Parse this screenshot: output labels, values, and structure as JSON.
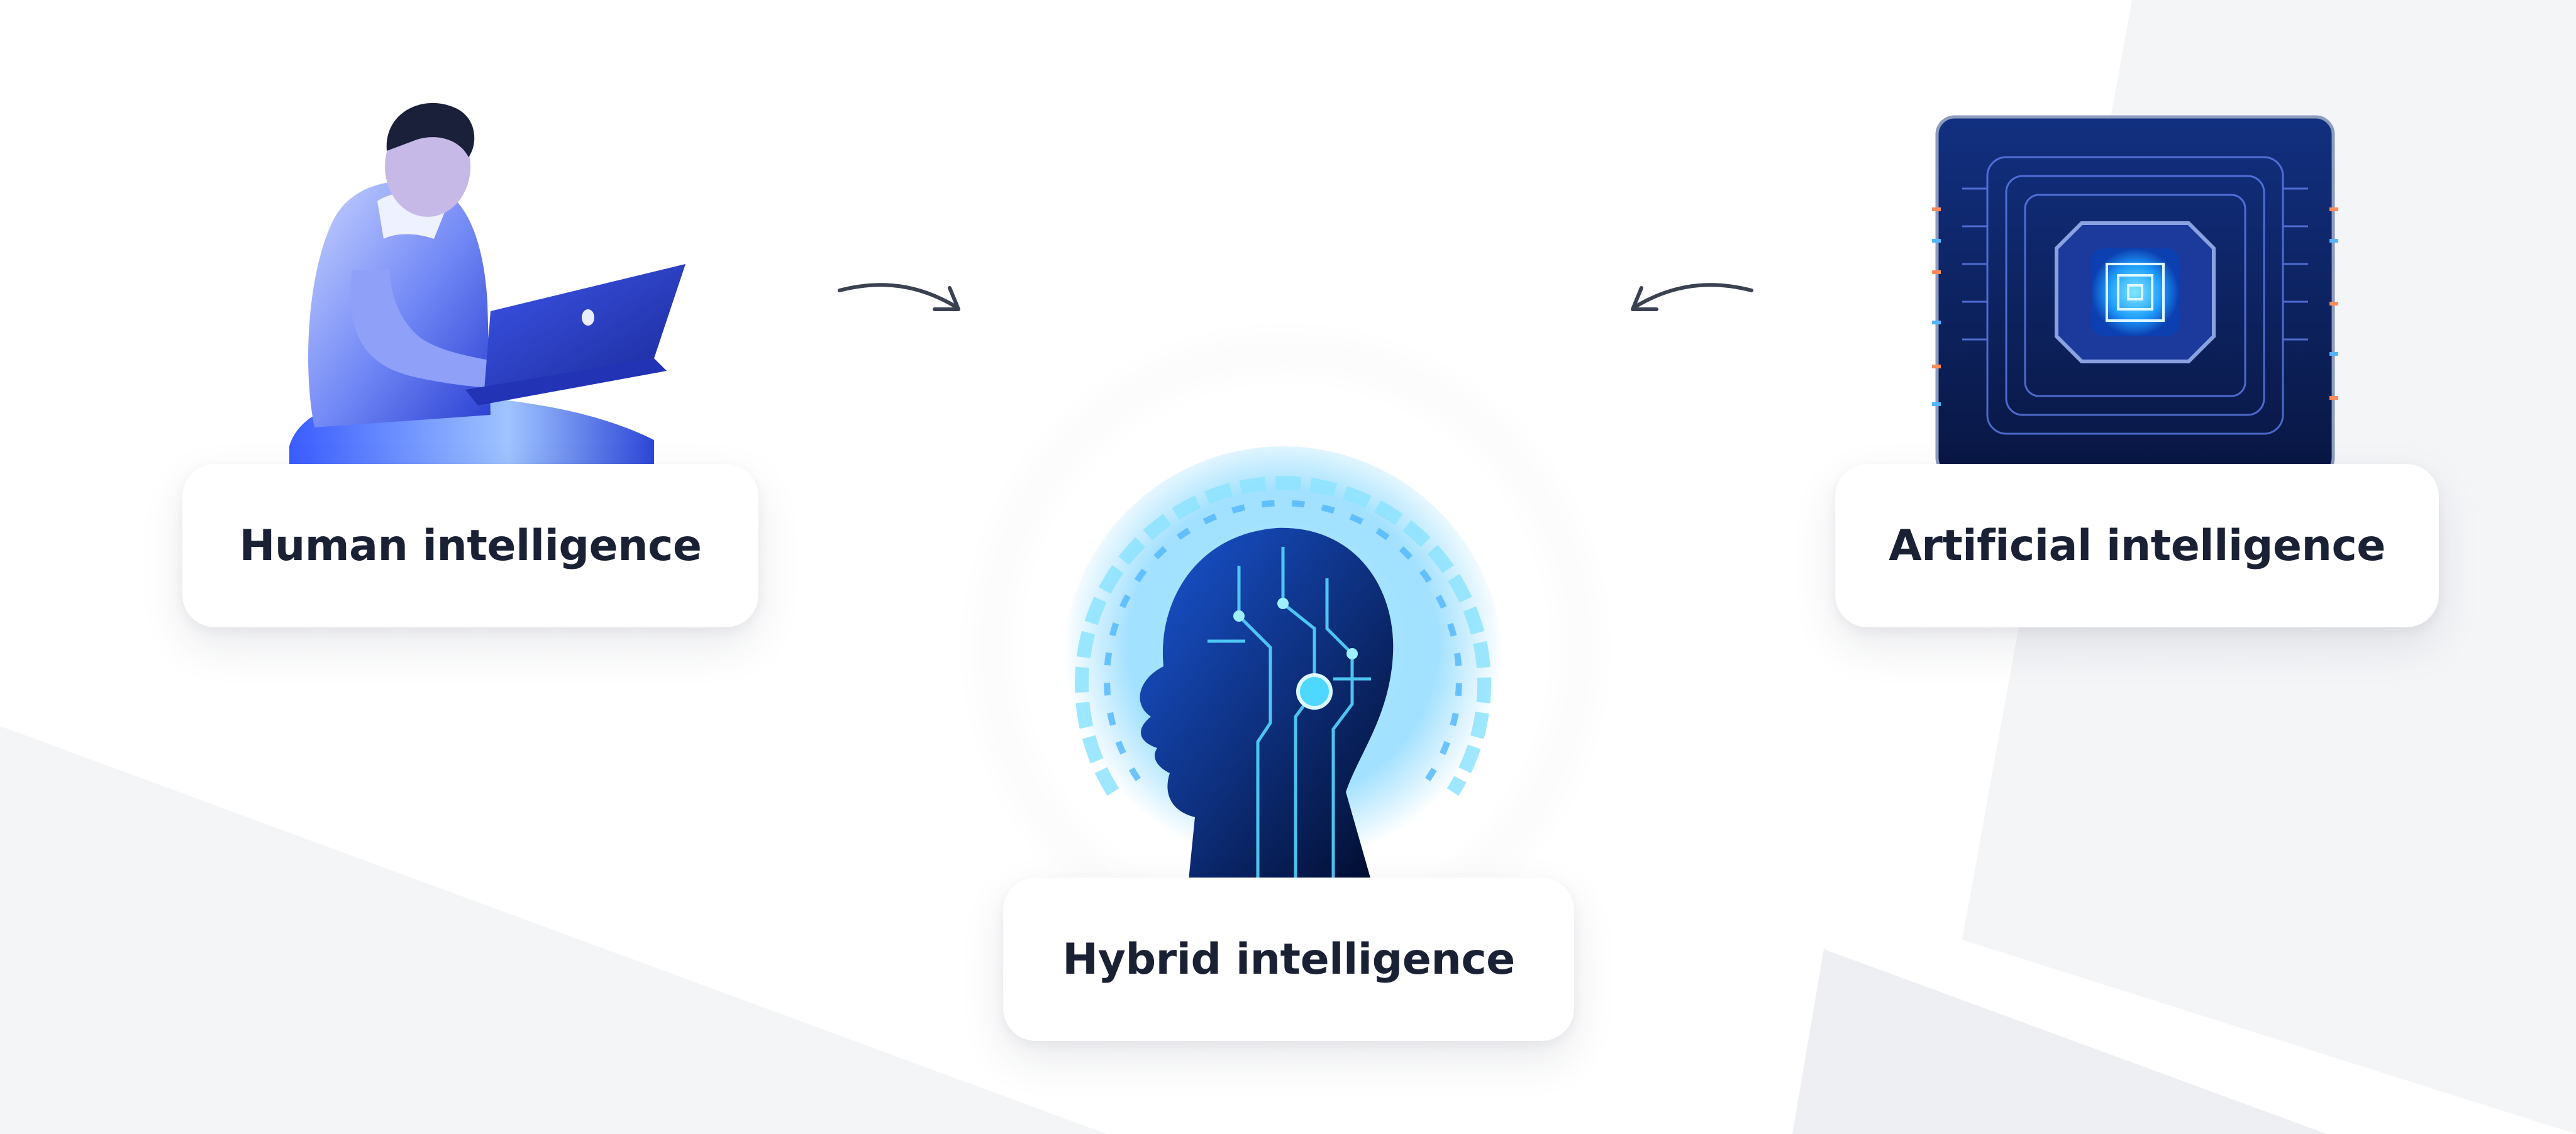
{
  "diagram": {
    "nodes": {
      "human": {
        "label": "Human intelligence",
        "icon": "person-with-laptop-illustration"
      },
      "artificial": {
        "label": "Artificial intelligence",
        "icon": "processor-chip-illustration"
      },
      "hybrid": {
        "label": "Hybrid intelligence",
        "icon": "circuit-head-illustration"
      }
    },
    "edges": [
      {
        "from": "human",
        "to": "hybrid",
        "icon": "curved-arrow-right-icon"
      },
      {
        "from": "artificial",
        "to": "hybrid",
        "icon": "curved-arrow-left-icon"
      }
    ]
  },
  "colors": {
    "background": "#ffffff",
    "background_shapes": "#f4f5f7",
    "label_text": "#1b2135",
    "arrow": "#3a4150",
    "accent_blue": "#1e6bff",
    "accent_cyan": "#4fd8ff",
    "chip_dark": "#0a1a4a"
  }
}
